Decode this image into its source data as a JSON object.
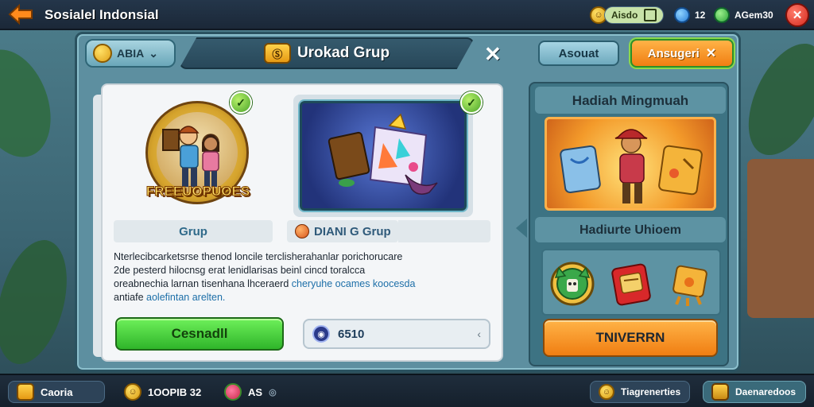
{
  "topbar": {
    "title": "Sosialel Indonsial",
    "currency1_label": "Aisdo",
    "currency1_icon": "coin-icon",
    "gems_value": "12",
    "energy_value": "AGem30",
    "menu_icon": "close-icon"
  },
  "panel": {
    "tab_label": "ABIA",
    "title": "Urokad Grup",
    "title_icon_text": "Ⓢ",
    "secondary_button": "Asouat",
    "primary_button": "Ansugeri"
  },
  "left": {
    "badge_label": "FREEUOPUOES",
    "badge_check": "✓",
    "grup_label": "Grup",
    "art_check": "✓",
    "grup2_label": "DIANI G Grup",
    "desc_lines": [
      "Nterlecibcarketsrse thenod loncile terclisherahanlar porichorucare",
      "2de pesterd hilocnsg erat lenidlarisas beinl cincd toralcca",
      "oreabnechia larnan tisenhana  lhceraerd"
    ],
    "desc_link1": "cheryuhe ocames koocesda",
    "desc_last_prefix": "antiafe ",
    "desc_link2": "aolefintan arelten.",
    "green_button": "Cesnadll",
    "input_value": "6510",
    "input_stepper": "‹"
  },
  "right": {
    "reward_title": "Hadiah Mingmuah",
    "reward_sub": "Hadiurte Uhioem",
    "orange_button": "TNIVERRN"
  },
  "bottombar": {
    "left_label": "Caoria",
    "coin_value": "1OOPIB 32",
    "gift_value": "AS",
    "gift_suffix": "◎",
    "right1_label": "Tiagrenerties",
    "right2_label": "Daenaredoos"
  }
}
